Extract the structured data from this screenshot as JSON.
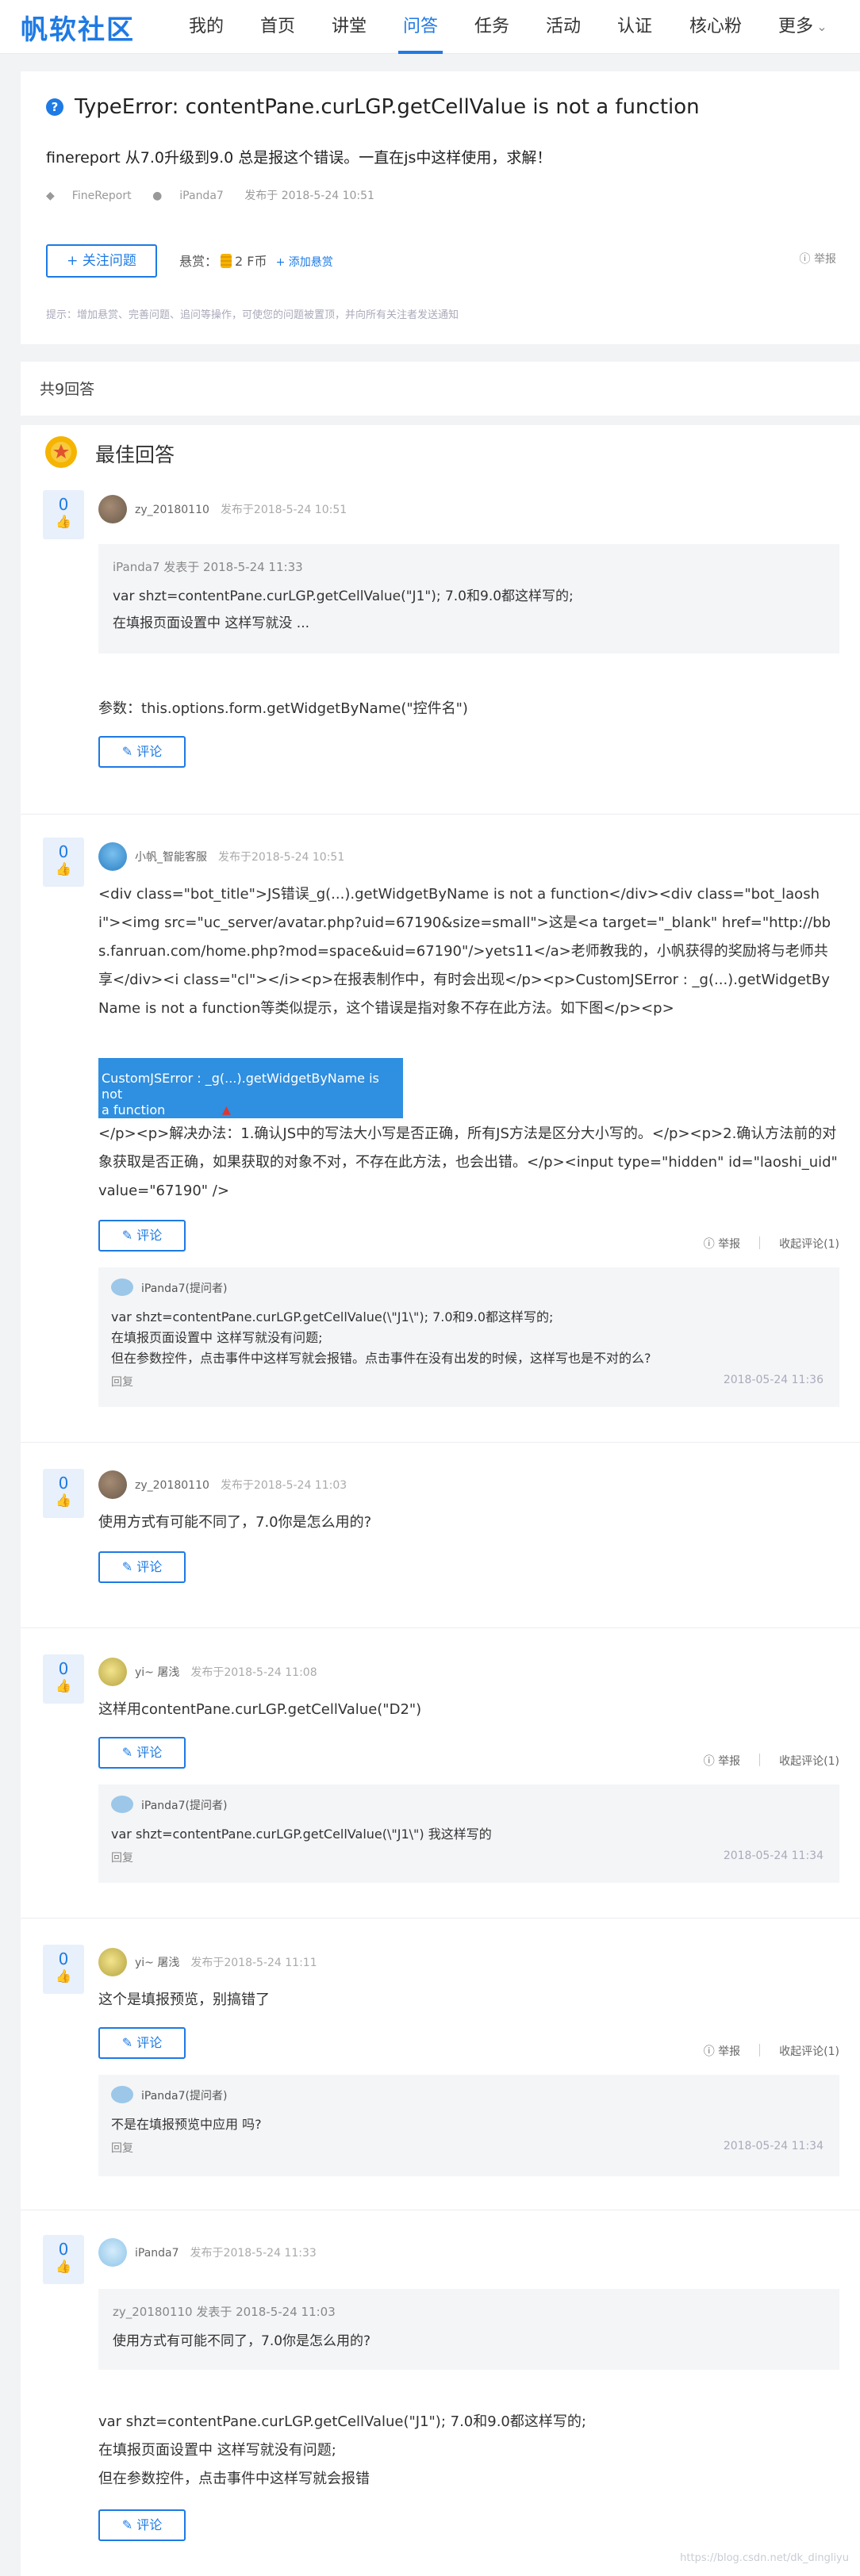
{
  "nav": {
    "logo": "帆软社区",
    "items": [
      "我的",
      "首页",
      "讲堂",
      "问答",
      "任务",
      "活动",
      "认证",
      "核心粉",
      "更多"
    ],
    "more_arrow": "⌄"
  },
  "question": {
    "icon": "?",
    "title": "TypeError: contentPane.curLGP.getCellValue is not a function",
    "desc": "finereport 从7.0升级到9.0 总是报这个错误。一直在js中这样使用，求解！",
    "tag": "FineReport",
    "author": "iPanda7",
    "posted": "发布于 2018-5-24 10:51",
    "follow_label": "+ 关注问题",
    "bounty_label": "悬赏：",
    "bounty_value": "2 F币",
    "add_bounty": "+ 添加悬赏",
    "report": "举报",
    "tip": "提示：增加悬赏、完善问题、追问等操作，可使您的问题被置顶，并向所有关注者发送通知"
  },
  "answers_count": "共9回答",
  "best_label": "最佳回答",
  "comment_label": "评论",
  "report_label": "举报",
  "collapse_label": "收起评论(1)",
  "reply_label": "回复",
  "answers": [
    {
      "votes": "0",
      "user": "zy_20180110",
      "time": "发布于2018-5-24 10:51",
      "quote_head": "iPanda7 发表于 2018-5-24 11:33",
      "quote_line1": "var shzt=contentPane.curLGP.getCellValue(\"J1\"); 7.0和9.0都这样写的;",
      "quote_line2": "在填报页面设置中 这样写就没 ...",
      "text": "参数：this.options.form.getWidgetByName(\"控件名\")"
    },
    {
      "votes": "0",
      "user": "小帆_智能客服",
      "time": "发布于2018-5-24 10:51",
      "text": "<div class=\"bot_title\">JS错误_g(...).getWidgetByName is not a function</div><div class=\"bot_laoshi\"><img src=\"uc_server/avatar.php?uid=67190&size=small\">这是<a target=\"_blank\" href=\"http://bbs.fanruan.com/home.php?mod=space&uid=67190\"/>yets11</a>老师教我的，小帆获得的奖励将与老师共享</div><i class=\"cl\"></i><p>在报表制作中，有时会出现</p><p>CustomJSError : _g(...).getWidgetByName is not a function等类似提示，这个错误是指对象不存在此方法。如下图</p><p>",
      "err_line1": "CustomJSError : _g(...).getWidgetByName is not",
      "err_line2": "a function",
      "text2": "</p><p>解决办法：1.确认JS中的写法大小写是否正确，所有JS方法是区分大小写的。</p><p>2.确认方法前的对象获取是否正确，如果获取的对象不对，不存在此方法，也会出错。</p><input type=\"hidden\" id=\"laoshi_uid\" value=\"67190\" />",
      "reply_user": "iPanda7(提问者)",
      "reply_line1": "var shzt=contentPane.curLGP.getCellValue(\\\"J1\\\"); 7.0和9.0都这样写的;",
      "reply_line2": "在填报页面设置中 这样写就没有问题;",
      "reply_line3": "但在参数控件，点击事件中这样写就会报错。点击事件在没有出发的时候，这样写也是不对的么?",
      "reply_date": "2018-05-24 11:36"
    },
    {
      "votes": "0",
      "user": "zy_20180110",
      "time": "发布于2018-5-24 11:03",
      "text": "使用方式有可能不同了，7.0你是怎么用的?"
    },
    {
      "votes": "0",
      "user": "yi~ 屠浅",
      "time": "发布于2018-5-24 11:08",
      "text": "这样用contentPane.curLGP.getCellValue(\"D2\")",
      "reply_user": "iPanda7(提问者)",
      "reply_line1": "var shzt=contentPane.curLGP.getCellValue(\\\"J1\\\") 我这样写的",
      "reply_date": "2018-05-24 11:34"
    },
    {
      "votes": "0",
      "user": "yi~ 屠浅",
      "time": "发布于2018-5-24 11:11",
      "text": "这个是填报预览，别搞错了",
      "reply_user": "iPanda7(提问者)",
      "reply_line1": "不是在填报预览中应用 吗?",
      "reply_date": "2018-05-24 11:34"
    },
    {
      "votes": "0",
      "user": "iPanda7",
      "time": "发布于2018-5-24 11:33",
      "quote_head": "zy_20180110 发表于 2018-5-24 11:03",
      "quote_line1": "使用方式有可能不同了，7.0你是怎么用的?",
      "text_line1": "var shzt=contentPane.curLGP.getCellValue(\"J1\"); 7.0和9.0都这样写的;",
      "text_line2": "在填报页面设置中 这样写就没有问题;",
      "text_line3": "但在参数控件，点击事件中这样写就会报错"
    }
  ],
  "watermark": "https://blog.csdn.net/dk_dingliyu"
}
